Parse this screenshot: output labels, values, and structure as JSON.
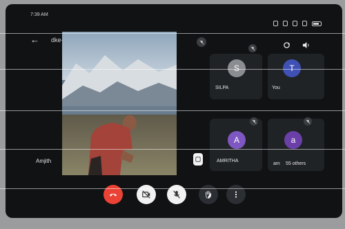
{
  "status_bar": {
    "time": "7:39 AM",
    "icons": [
      "alarm-icon",
      "vibrate-icon",
      "signal-icon",
      "wifi-icon",
      "battery-icon"
    ]
  },
  "header": {
    "meeting_code": "dke-ppzs-qiv ›",
    "back_icon": "back-arrow-icon"
  },
  "main_video": {
    "participant": "Amjith"
  },
  "top_controls": {
    "icons": [
      "switch-camera-icon",
      "speaker-icon"
    ]
  },
  "tiles": [
    {
      "name": "SILPA",
      "initial": "S",
      "color": "#8a8d91",
      "muted": true
    },
    {
      "name": "You",
      "initial": "T",
      "color": "#3f51b5",
      "muted": false
    },
    {
      "name": "AMRITHA",
      "initial": "A",
      "color": "#7e57c2",
      "muted": true
    },
    {
      "name": "am",
      "initial": "a",
      "color": "#6a3fa8",
      "muted": true,
      "others_text": "55 others"
    }
  ],
  "controls": {
    "end_call": {
      "icon": "end-call-icon",
      "color": "#ea4335"
    },
    "video_off": {
      "icon": "video-off-icon"
    },
    "mic_off": {
      "icon": "mic-off-icon"
    },
    "raise_hand": {
      "icon": "raise-hand-icon"
    },
    "more": {
      "icon": "more-vert-icon"
    }
  },
  "colors": {
    "background": "#111214",
    "tile": "#202326",
    "end_call": "#ea4335"
  }
}
